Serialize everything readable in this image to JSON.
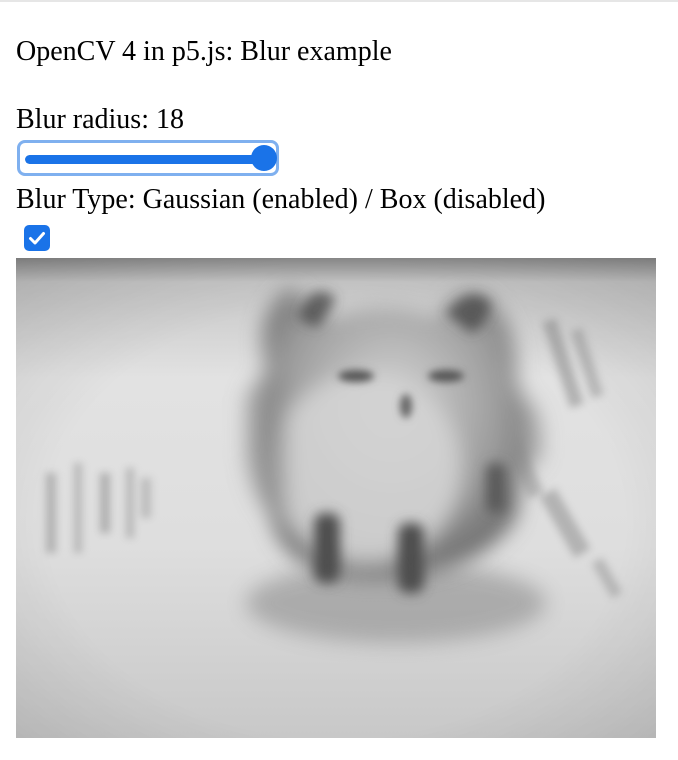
{
  "page": {
    "title": "OpenCV 4 in p5.js: Blur example"
  },
  "blur_radius": {
    "label": "Blur radius: 18",
    "value": 18,
    "fraction": 0.97
  },
  "blur_type": {
    "label": "Blur Type: Gaussian (enabled) / Box (disabled)",
    "checked": true
  },
  "colors": {
    "accent": "#1a73e8",
    "focus_ring": "#7fb0ef"
  },
  "icons": {
    "checkbox": "checkmark-icon"
  }
}
